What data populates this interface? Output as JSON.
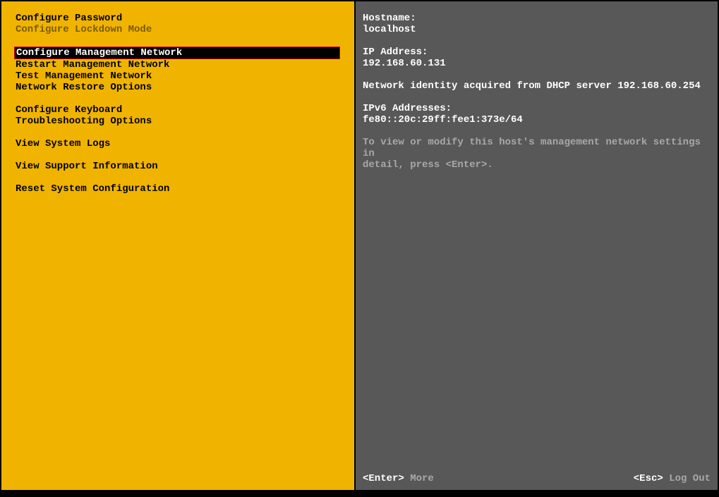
{
  "menu": {
    "configure_password": "Configure Password",
    "configure_lockdown_mode": "Configure Lockdown Mode",
    "configure_management_network": "Configure Management Network",
    "restart_management_network": "Restart Management Network",
    "test_management_network": "Test Management Network",
    "network_restore_options": "Network Restore Options",
    "configure_keyboard": "Configure Keyboard",
    "troubleshooting_options": "Troubleshooting Options",
    "view_system_logs": "View System Logs",
    "view_support_information": "View Support Information",
    "reset_system_configuration": "Reset System Configuration"
  },
  "details": {
    "hostname_label": "Hostname:",
    "hostname_value": "localhost",
    "ip_label": "IP Address:",
    "ip_value": "192.168.60.131",
    "dhcp_line": "Network identity acquired from DHCP server 192.168.60.254",
    "ipv6_label": "IPv6 Addresses:",
    "ipv6_value": "fe80::20c:29ff:fee1:373e/64",
    "note_line1": "To view or modify this host's management network settings in",
    "note_line2": "detail, press <Enter>."
  },
  "footer": {
    "enter_key": "<Enter>",
    "enter_label": "More",
    "esc_key": "<Esc>",
    "esc_label": "Log Out"
  }
}
